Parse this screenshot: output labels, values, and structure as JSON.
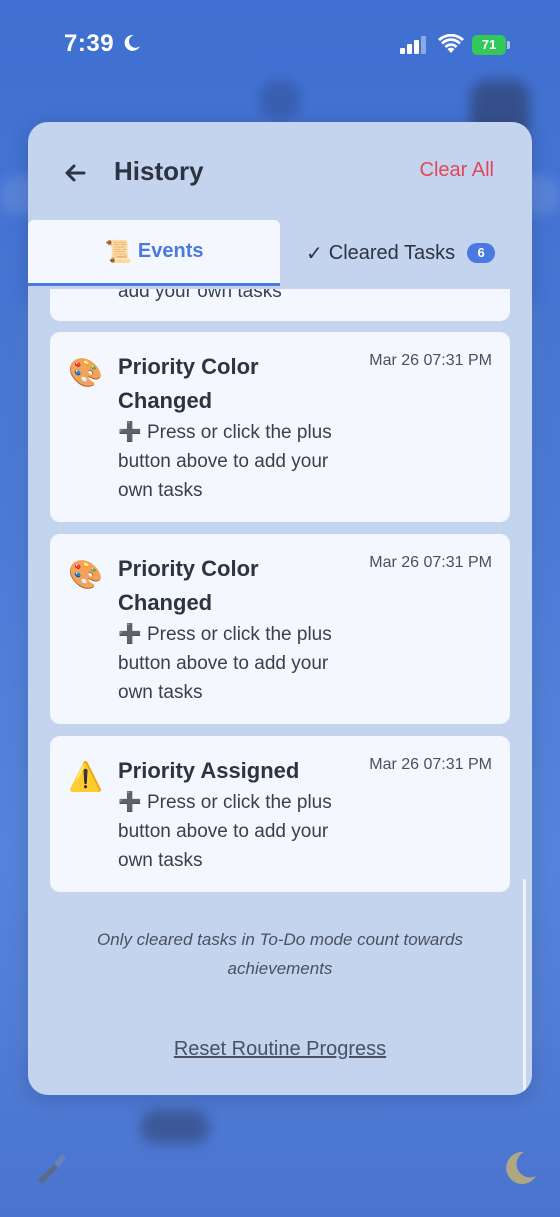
{
  "status_bar": {
    "time": "7:39",
    "battery": "71"
  },
  "header": {
    "title": "History",
    "clear_all": "Clear All"
  },
  "tabs": {
    "events": {
      "icon": "📜",
      "label": "Events"
    },
    "cleared": {
      "icon": "✓",
      "label": "Cleared Tasks",
      "count": "6"
    }
  },
  "events": [
    {
      "icon": "",
      "title": "",
      "time": "",
      "description": "add your own tasks"
    },
    {
      "icon": "🎨",
      "title": "Priority Color Changed",
      "time": "Mar 26 07:31 PM",
      "description_icon": "➕",
      "description": "Press or click the plus button above to add your own tasks"
    },
    {
      "icon": "🎨",
      "title": "Priority Color Changed",
      "time": "Mar 26 07:31 PM",
      "description_icon": "➕",
      "description": "Press or click the plus button above to add your own tasks"
    },
    {
      "icon": "⚠️",
      "title": "Priority Assigned",
      "time": "Mar 26 07:31 PM",
      "description_icon": "➕",
      "description": "Press or click the plus button above to add your own tasks"
    }
  ],
  "footnote": "Only cleared tasks in To-Do mode count towards achievements",
  "reset_link": "Reset Routine Progress",
  "colors": {
    "accent": "#4a79e0",
    "danger": "#e2475a",
    "modal_bg": "#c4d4ee",
    "card_bg": "#f4f7fe"
  }
}
